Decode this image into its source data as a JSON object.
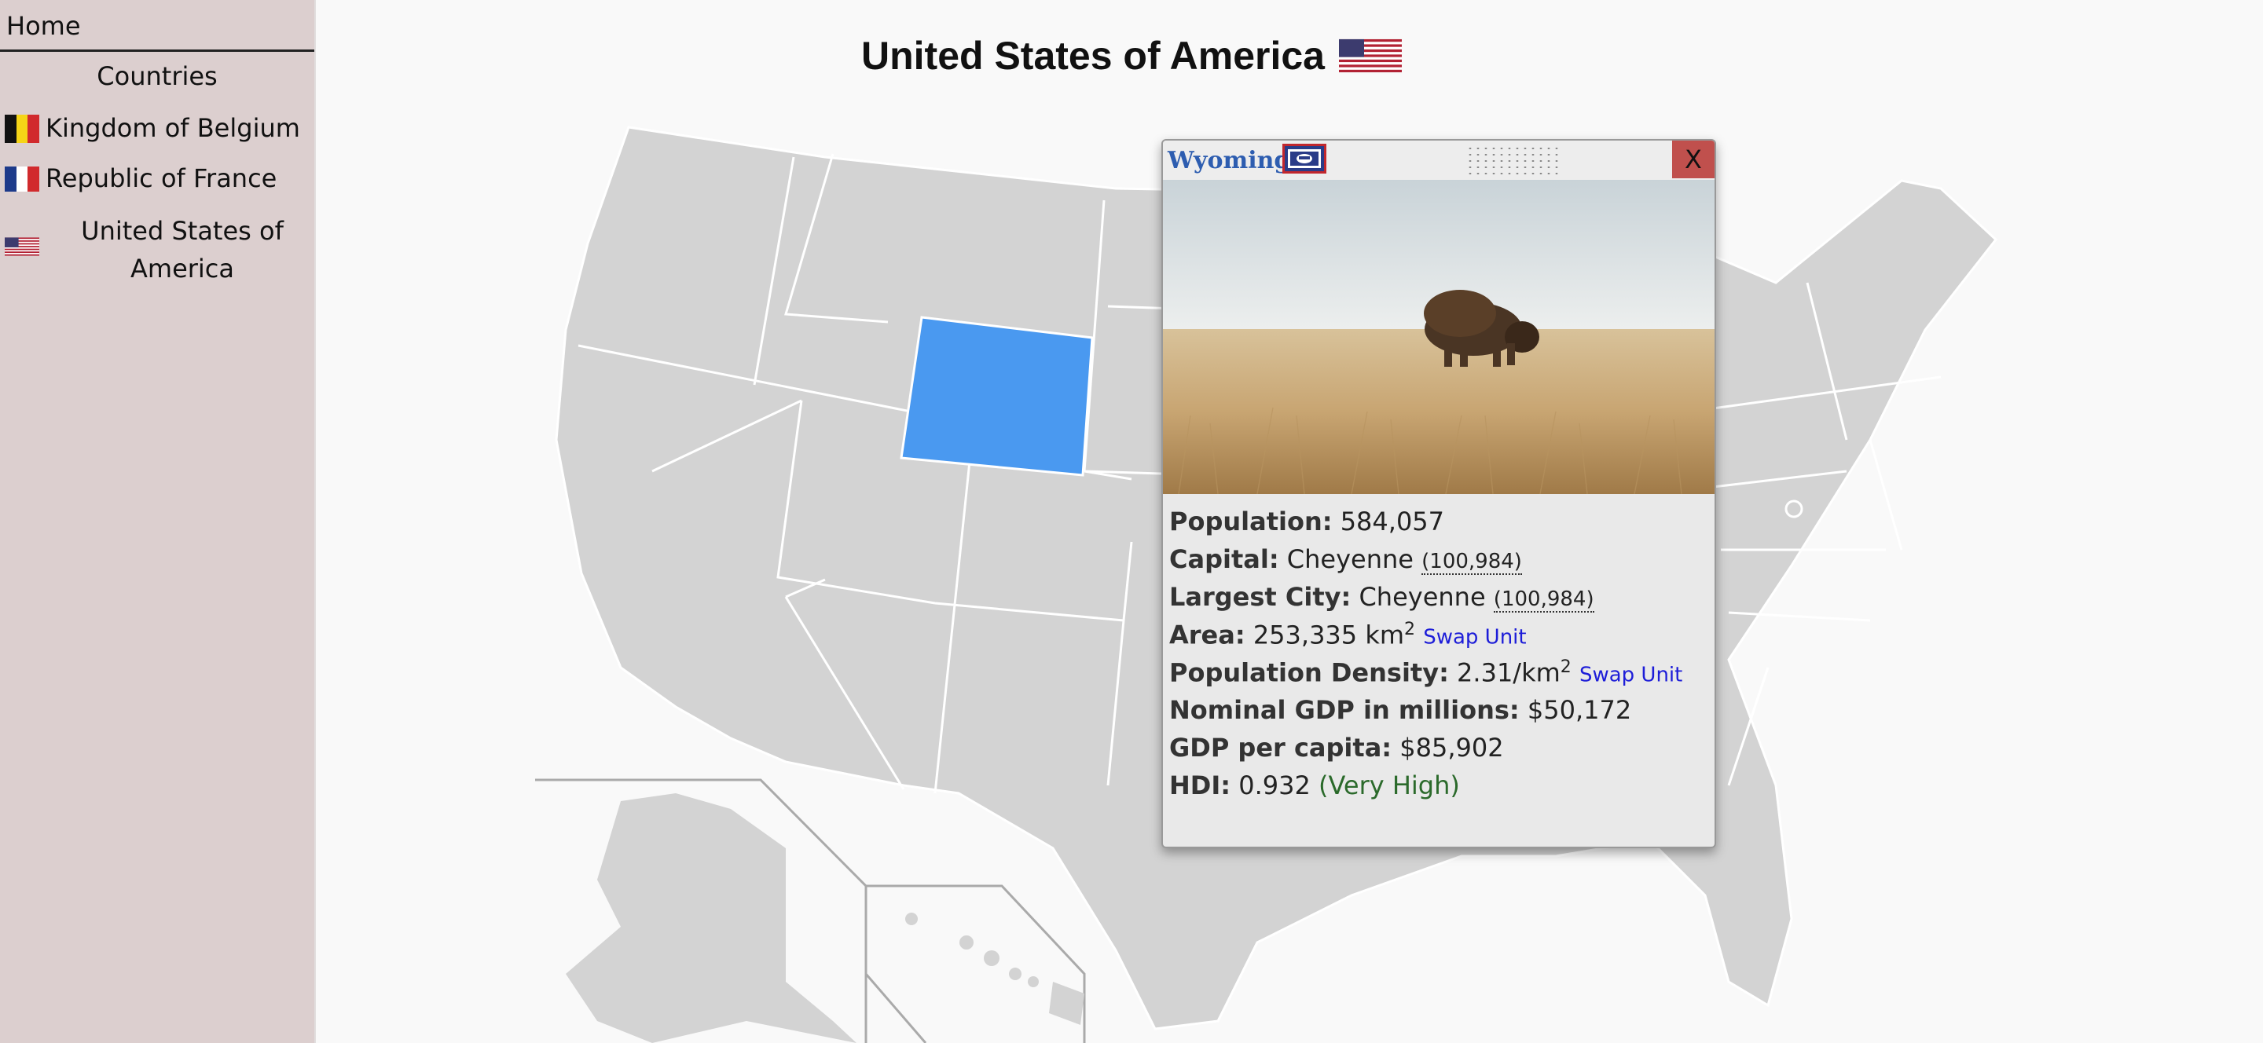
{
  "sidebar": {
    "home": "Home",
    "countries_title": "Countries",
    "items": [
      {
        "label": "Kingdom of Belgium",
        "flag": "belgium-flag"
      },
      {
        "label": "Republic of France",
        "flag": "france-flag"
      },
      {
        "label_line1": "United States of",
        "label_line2": "America",
        "flag": "usa-flag"
      }
    ]
  },
  "title": "United States of America",
  "colors": {
    "sidebar_bg": "#dccfcf",
    "selected_state": "#4a99f0",
    "state_fill": "#d3d3d3",
    "popup_title": "#2d5db0",
    "close_button": "#c0504d",
    "swap_link": "#1d1dd8",
    "hdi_level": "#2b6a2b"
  },
  "map": {
    "selected_state": "Wyoming"
  },
  "popup": {
    "state_name": "Wyoming",
    "close_label": "X",
    "photo_subject": "bison in prairie grassland",
    "stats": {
      "population_label": "Population:",
      "population_value": "584,057",
      "capital_label": "Capital:",
      "capital_value": "Cheyenne",
      "capital_pop": "(100,984)",
      "largest_label": "Largest City:",
      "largest_value": "Cheyenne",
      "largest_pop": "(100,984)",
      "area_label": "Area:",
      "area_value": "253,335 km",
      "area_sup": "2",
      "area_swap": "Swap Unit",
      "density_label": "Population Density:",
      "density_value": "2.31/km",
      "density_sup": "2",
      "density_swap": "Swap Unit",
      "gdp_label": "Nominal GDP in millions:",
      "gdp_value": "$50,172",
      "gdppc_label": "GDP per capita:",
      "gdppc_value": "$85,902",
      "hdi_label": "HDI:",
      "hdi_value": "0.932",
      "hdi_level": "(Very High)"
    }
  }
}
